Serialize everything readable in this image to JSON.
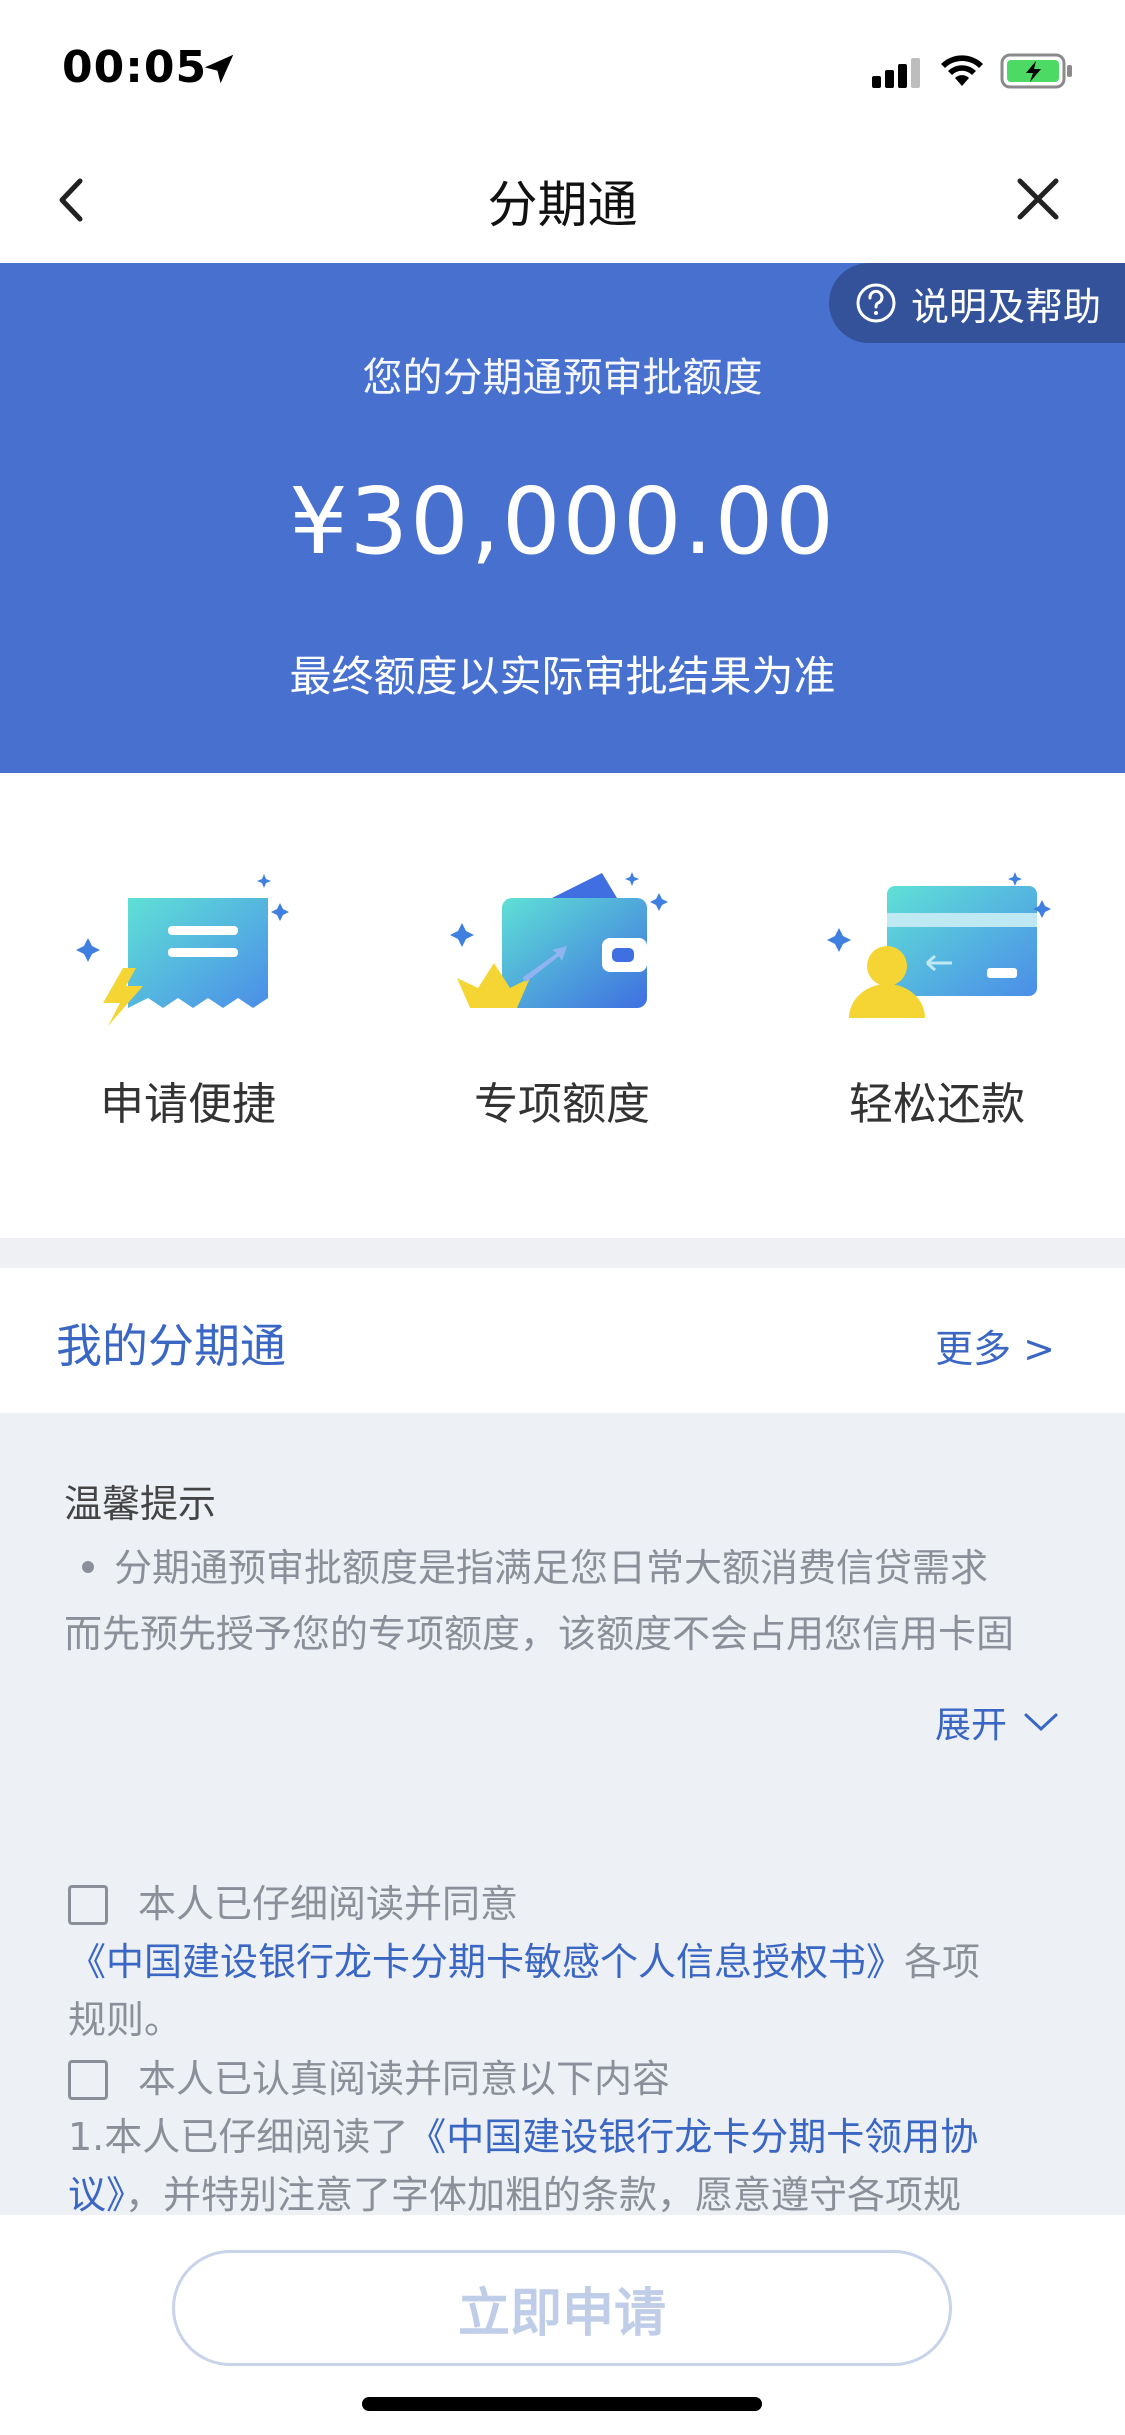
{
  "status_bar": {
    "time": "00:05"
  },
  "nav": {
    "title": "分期通"
  },
  "hero": {
    "help_label": "说明及帮助",
    "label": "您的分期通预审批额度",
    "amount": "¥30,000.00",
    "note": "最终额度以实际审批结果为准",
    "colors": {
      "background": "#4870cf",
      "pill": "#34529a"
    }
  },
  "features": [
    {
      "label": "申请便捷",
      "icon": "receipt-lightning-icon"
    },
    {
      "label": "专项额度",
      "icon": "wallet-crown-icon"
    },
    {
      "label": "轻松还款",
      "icon": "card-person-icon"
    }
  ],
  "my_section": {
    "title": "我的分期通",
    "more": "更多 >"
  },
  "tips": {
    "title": "温馨提示",
    "text_line1": "分期通预审批额度是指满足您日常大额消费信贷需求",
    "text_line2": "而先预先授予您的专项额度，该额度不会占用您信用卡固",
    "expand_label": "展开"
  },
  "agreements": [
    {
      "prefix": "本人已仔细阅读并同意",
      "link": "《中国建设银行龙卡分期卡敏感个人信息授权书》",
      "suffix_inline": "各项",
      "suffix": "规则。"
    },
    {
      "prefix": "本人已认真阅读并同意以下内容",
      "item_text": "1.本人已仔细阅读了",
      "link": "《中国建设银行龙卡分期卡领用协议》",
      "suffix": "，并特别注意了字体加粗的条款，愿意遵守各项规"
    }
  ],
  "bottom": {
    "apply_label": "立即申请"
  }
}
